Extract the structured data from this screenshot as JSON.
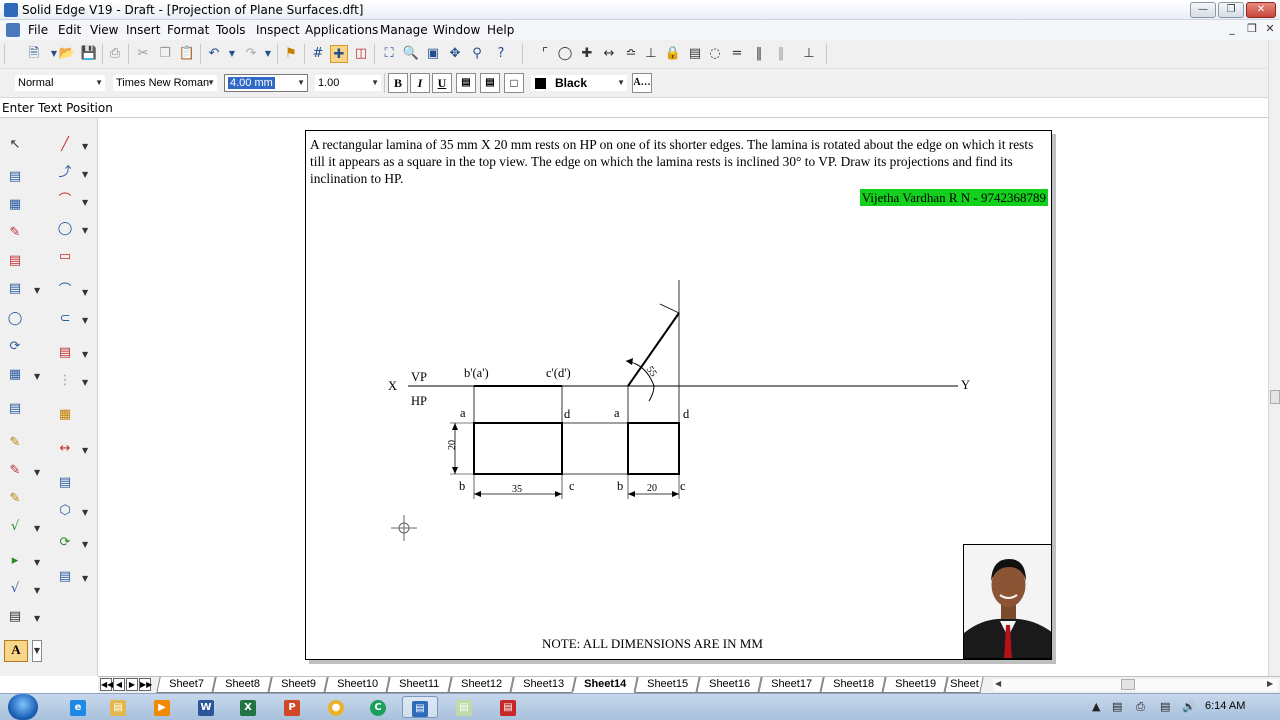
{
  "window": {
    "title": "Solid Edge V19 - Draft - [Projection of Plane Surfaces.dft]"
  },
  "menu": [
    "File",
    "Edit",
    "View",
    "Insert",
    "Format",
    "Tools",
    "Inspect",
    "Applications",
    "Manage",
    "Window",
    "Help"
  ],
  "formatting": {
    "style": "Normal",
    "font": "Times New Roman",
    "size": "4.00 mm",
    "spacing": "1.00",
    "bold": "B",
    "italic": "I",
    "underline": "U",
    "color": "Black",
    "color_hex": "#000000"
  },
  "prompt": "Enter Text Position",
  "sheet": {
    "problem": "A rectangular lamina of 35 mm X 20 mm rests on HP on one of its shorter edges. The lamina is rotated about the edge on which it rests till it appears as a square in the top view. The edge on which the lamina rests is inclined 30° to VP. Draw its projections and find its inclination to HP.",
    "author": "Vijetha Vardhan R N - 9742368789",
    "author_bg": "#12d01b",
    "note": "NOTE: ALL DIMENSIONS ARE IN MM"
  },
  "drawing": {
    "x": "X",
    "y": "Y",
    "vp": "VP",
    "hp": "HP",
    "b_a_prime": "b'(a')",
    "c_d_prime": "c'(d')",
    "a1": "a",
    "d1": "d",
    "b1": "b",
    "c1": "c",
    "a2": "a",
    "d2": "d",
    "b2": "b",
    "c2": "c",
    "dim_20_v": "20",
    "dim_35": "35",
    "dim_20_h": "20",
    "angle": "55"
  },
  "tabs": [
    "Sheet7",
    "Sheet8",
    "Sheet9",
    "Sheet10",
    "Sheet11",
    "Sheet12",
    "Sheet13",
    "Sheet14",
    "Sheet15",
    "Sheet16",
    "Sheet17",
    "Sheet18",
    "Sheet19",
    "Sheet"
  ],
  "active_tab": "Sheet14",
  "taskbar": {
    "clock": "6:14 AM"
  }
}
